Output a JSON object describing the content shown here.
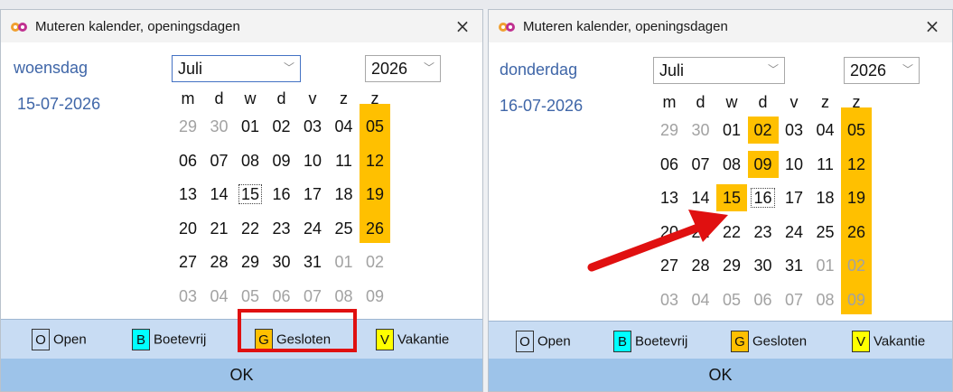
{
  "colors": {
    "gesloten": "#ffc000",
    "open": "#ffffff",
    "boetevrij": "#00ffff",
    "vakantie": "#ffff00",
    "ok_bar": "#9dc3e9",
    "legend_bar": "#c8dcf3",
    "date_text": "#3f66a8",
    "annotation_red": "#e01010"
  },
  "weekday_headers": [
    "m",
    "d",
    "w",
    "d",
    "v",
    "z",
    "z"
  ],
  "legend": [
    {
      "code": "O",
      "label": "Open",
      "color": "#ffffff"
    },
    {
      "code": "B",
      "label": "Boetevrij",
      "color": "#00ffff"
    },
    {
      "code": "G",
      "label": "Gesloten",
      "color": "#ffc000"
    },
    {
      "code": "V",
      "label": "Vakantie",
      "color": "#ffff00"
    }
  ],
  "dialogs": [
    {
      "title": "Muteren kalender, openingsdagen",
      "close_icon": "×",
      "day_name": "woensdag",
      "date": "15-07-2026",
      "month": "Juli",
      "year": "2026",
      "focused_day": "15",
      "closed_days": [
        "05",
        "12",
        "19",
        "26"
      ],
      "ok_label": "OK"
    },
    {
      "title": "Muteren kalender, openingsdagen",
      "close_icon": "×",
      "day_name": "donderdag",
      "date": "16-07-2026",
      "month": "Juli",
      "year": "2026",
      "focused_day": "16",
      "closed_days": [
        "05",
        "12",
        "15",
        "19",
        "26",
        "02",
        "09"
      ],
      "ok_label": "OK"
    }
  ],
  "calendar_weeks": [
    [
      "29",
      "30",
      "01",
      "02",
      "03",
      "04",
      "05"
    ],
    [
      "06",
      "07",
      "08",
      "09",
      "10",
      "11",
      "12"
    ],
    [
      "13",
      "14",
      "15",
      "16",
      "17",
      "18",
      "19"
    ],
    [
      "20",
      "21",
      "22",
      "23",
      "24",
      "25",
      "26"
    ],
    [
      "27",
      "28",
      "29",
      "30",
      "31",
      "01",
      "02"
    ],
    [
      "03",
      "04",
      "05",
      "06",
      "07",
      "08",
      "09"
    ]
  ],
  "dropdown_icon": "chevron-down-icon",
  "window_icon": "infinity-logo-icon"
}
